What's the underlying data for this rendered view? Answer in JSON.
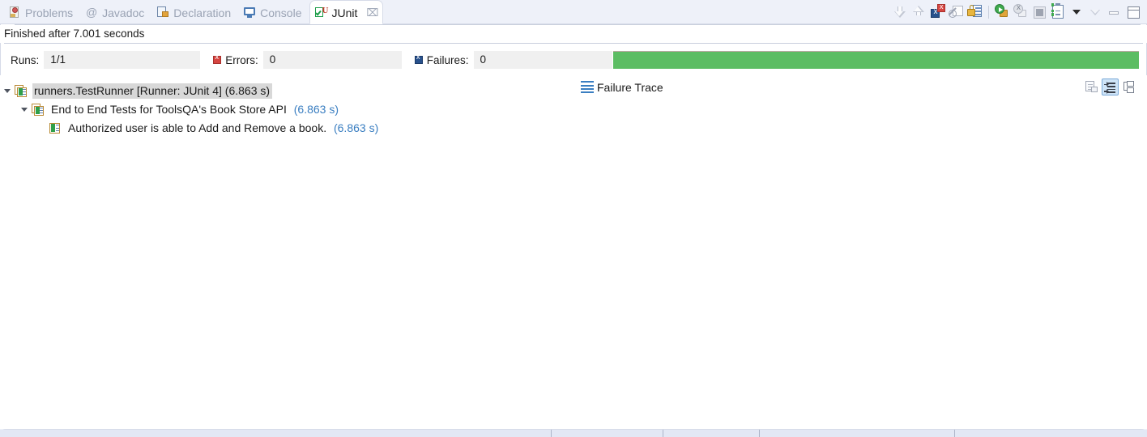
{
  "tabs": [
    {
      "label": "Problems",
      "icon": "problems-icon",
      "active": false
    },
    {
      "label": "Javadoc",
      "icon": "at-icon",
      "active": false
    },
    {
      "label": "Declaration",
      "icon": "declaration-icon",
      "active": false
    },
    {
      "label": "Console",
      "icon": "console-icon",
      "active": false
    },
    {
      "label": "JUnit",
      "icon": "junit-icon",
      "active": true,
      "close": "⌧"
    }
  ],
  "toolbar": {
    "items": [
      {
        "name": "show-next-failed-arrow-down",
        "title": "Next Failed Test"
      },
      {
        "name": "show-previous-failed-arrow-up",
        "title": "Previous Failed Test"
      },
      {
        "name": "show-failures-only-icon",
        "title": "Show Failures Only"
      },
      {
        "name": "show-ignored-only-icon",
        "title": "Show Ignored Only"
      },
      {
        "name": "scroll-lock-icon",
        "title": "Scroll Lock"
      },
      {
        "name": "rerun-test-icon",
        "title": "Rerun Test"
      },
      {
        "name": "rerun-failed-first-icon",
        "title": "Rerun Test - Failures First"
      },
      {
        "name": "stop-icon",
        "title": "Stop JUnit Test Run"
      },
      {
        "name": "test-run-history-icon",
        "title": "Test Run History"
      },
      {
        "name": "view-menu-caret-icon",
        "title": "View Menu"
      },
      {
        "name": "minimize-hollow-caret-icon",
        "title": "Minimize"
      },
      {
        "name": "minimize-icon",
        "title": "Minimize"
      },
      {
        "name": "maximize-icon",
        "title": "Maximize"
      }
    ]
  },
  "status": {
    "text": "Finished after 7.001 seconds"
  },
  "counters": {
    "runs_label": "Runs:",
    "runs_value": "1/1",
    "errors_label": "Errors:",
    "errors_value": "0",
    "failures_label": "Failures:",
    "failures_value": "0"
  },
  "progress": {
    "percent": 100,
    "color": "#5cbd63"
  },
  "tree": {
    "rows": [
      {
        "depth": 0,
        "expanded": true,
        "icon": "test-suite-icon",
        "text": "runners.TestRunner [Runner: JUnit 4] (6.863 s)",
        "time": "",
        "selected": true
      },
      {
        "depth": 1,
        "expanded": true,
        "icon": "test-suite-icon",
        "text": "End to End Tests for ToolsQA's Book Store API",
        "time": "(6.863 s)",
        "selected": false
      },
      {
        "depth": 2,
        "expanded": false,
        "icon": "test-case-icon",
        "text": "Authorized user is able to Add and Remove a book.",
        "time": "(6.863 s)",
        "selected": false
      }
    ]
  },
  "failure_trace": {
    "title": "Failure Trace",
    "tools": [
      {
        "name": "compare-result-icon",
        "pressed": false
      },
      {
        "name": "filter-stack-trace-icon",
        "pressed": true
      },
      {
        "name": "show-stack-trace-in-console-icon",
        "pressed": false
      }
    ],
    "content": ""
  },
  "bottom_bar": {
    "dividers": [
      680,
      818,
      937,
      1178
    ]
  }
}
